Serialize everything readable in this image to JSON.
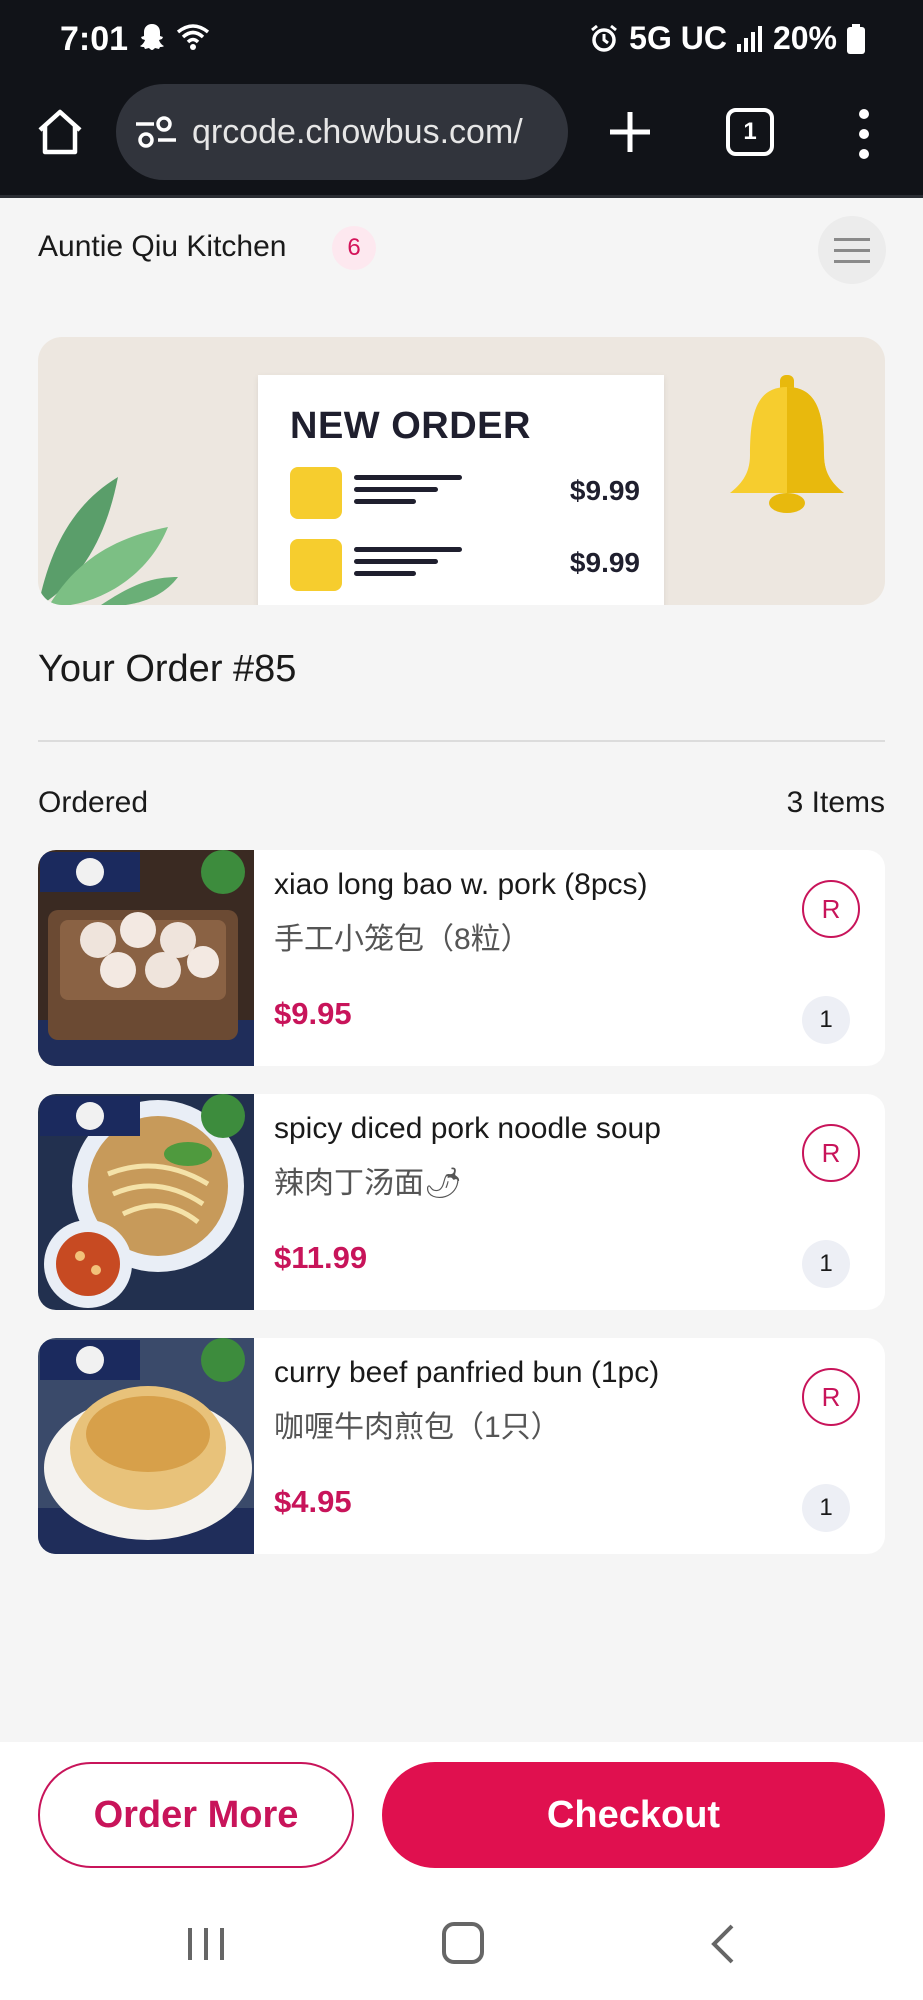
{
  "status_bar": {
    "time": "7:01",
    "network": "5G UC",
    "battery": "20%",
    "icons": [
      "snapchat-ghost-icon",
      "wifi-icon",
      "alarm-icon",
      "signal-icon",
      "battery-icon"
    ]
  },
  "browser": {
    "url": "qrcode.chowbus.com/",
    "tab_count": "1",
    "icons": [
      "home-icon",
      "site-settings-icon",
      "new-tab-plus-icon",
      "tab-switcher-icon",
      "more-vert-icon"
    ]
  },
  "header": {
    "restaurant_name": "Auntie Qiu Kitchen",
    "table_number": "6",
    "menu_icon": "hamburger-menu-icon"
  },
  "banner": {
    "title": "NEW ORDER",
    "rows": [
      {
        "price": "$9.99"
      },
      {
        "price": "$9.99"
      }
    ],
    "icons": [
      "leaf-icon",
      "bell-icon"
    ]
  },
  "order": {
    "title": "Your Order #85",
    "ordered_label": "Ordered",
    "items_count": "3 Items",
    "items": [
      {
        "name_en": "xiao long bao w. pork (8pcs)",
        "name_cn": "手工小笼包（8粒）",
        "price": "$9.95",
        "badge": "R",
        "quantity": "1"
      },
      {
        "name_en": "spicy diced pork noodle soup",
        "name_cn": "辣肉丁汤面🌶",
        "price": "$11.99",
        "badge": "R",
        "quantity": "1"
      },
      {
        "name_en": "curry beef panfried bun (1pc)",
        "name_cn": "咖喱牛肉煎包（1只）",
        "price": "$4.95",
        "badge": "R",
        "quantity": "1"
      }
    ]
  },
  "actions": {
    "order_more": "Order More",
    "checkout": "Checkout"
  },
  "colors": {
    "accent": "#e0104f",
    "accent_text": "#c8145a",
    "status_bar_bg": "#111318",
    "page_bg": "#f5f5f5"
  },
  "nav_bar": {
    "icons": [
      "recent-apps-icon",
      "home-nav-icon",
      "back-icon"
    ]
  }
}
